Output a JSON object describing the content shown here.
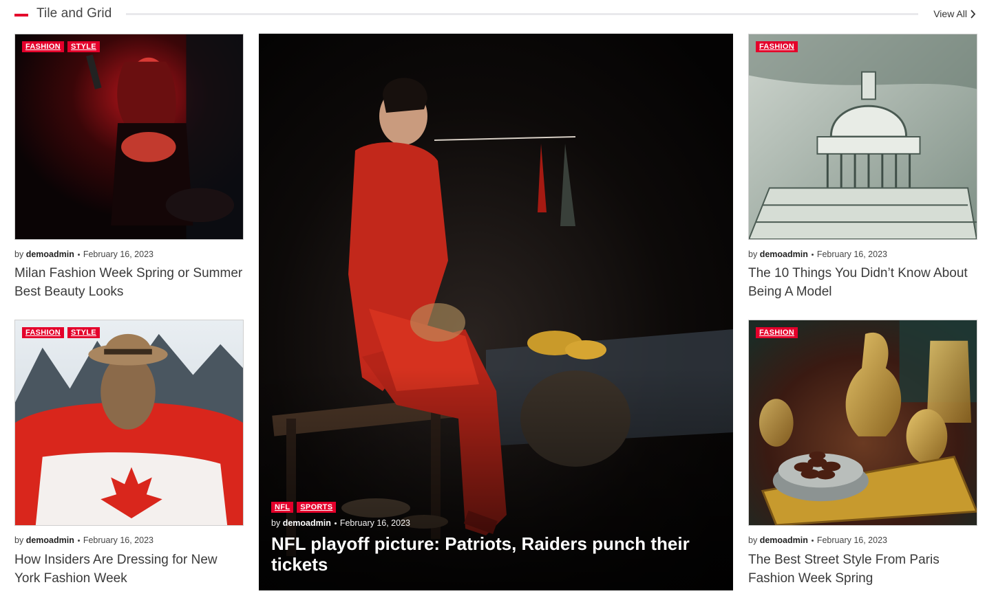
{
  "section": {
    "title": "Tile and Grid",
    "view_all": "View All"
  },
  "byline_prefix": "by",
  "cards": [
    {
      "categories": [
        "FASHION",
        "STYLE"
      ],
      "author": "demoadmin",
      "date": "February 16, 2023",
      "title": "Milan Fashion Week Spring or Summer Best Beauty Looks"
    },
    {
      "categories": [
        "FASHION",
        "STYLE"
      ],
      "author": "demoadmin",
      "date": "February 16, 2023",
      "title": "How Insiders Are Dressing for New York Fashion Week"
    },
    {
      "categories": [
        "NFL",
        "SPORTS"
      ],
      "author": "demoadmin",
      "date": "February 16, 2023",
      "title": "NFL playoff picture: Patriots, Raiders punch their tickets"
    },
    {
      "categories": [
        "FASHION"
      ],
      "author": "demoadmin",
      "date": "February 16, 2023",
      "title": "The 10 Things You Didn’t Know About Being A Model"
    },
    {
      "categories": [
        "FASHION"
      ],
      "author": "demoadmin",
      "date": "February 16, 2023",
      "title": "The Best Street Style From Paris Fashion Week Spring"
    }
  ],
  "colors": {
    "accent": "#e4002b",
    "title_text": "#3a3a3a"
  },
  "icons": {
    "view_all": "chevron-right-icon"
  }
}
